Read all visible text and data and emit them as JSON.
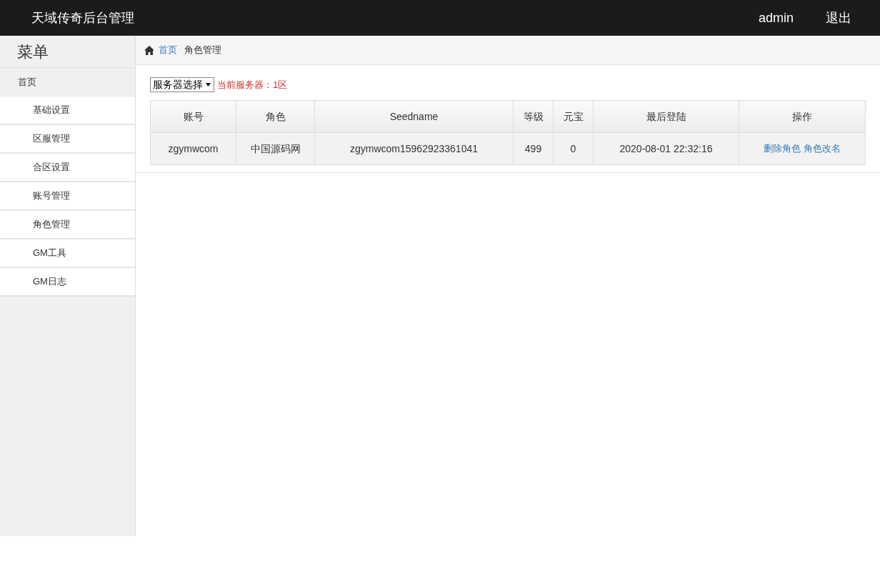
{
  "header": {
    "title": "天域传奇后台管理",
    "user": "admin",
    "logout": "退出"
  },
  "sidebar": {
    "title": "菜单",
    "items": [
      {
        "kind": "header",
        "label": "首页"
      },
      {
        "kind": "item",
        "label": "基础设置"
      },
      {
        "kind": "item",
        "label": "区服管理"
      },
      {
        "kind": "item",
        "label": "合区设置"
      },
      {
        "kind": "item",
        "label": "账号管理"
      },
      {
        "kind": "item",
        "label": "角色管理"
      },
      {
        "kind": "item",
        "label": "GM工具"
      },
      {
        "kind": "item",
        "label": "GM日志"
      }
    ]
  },
  "breadcrumb": {
    "home": "首页",
    "current": "角色管理"
  },
  "server_select": {
    "value": "服务器选择",
    "current": "当前服务器：1区"
  },
  "table": {
    "columns": [
      "账号",
      "角色",
      "Seedname",
      "等级",
      "元宝",
      "最后登陆",
      "操作"
    ],
    "rows": [
      {
        "cells": [
          "zgymwcom",
          "中国源码网",
          "zgymwcom15962923361041",
          "499",
          "0",
          "2020-08-01 22:32:16"
        ],
        "actions": [
          "删除角色",
          "角色改名"
        ]
      }
    ]
  }
}
